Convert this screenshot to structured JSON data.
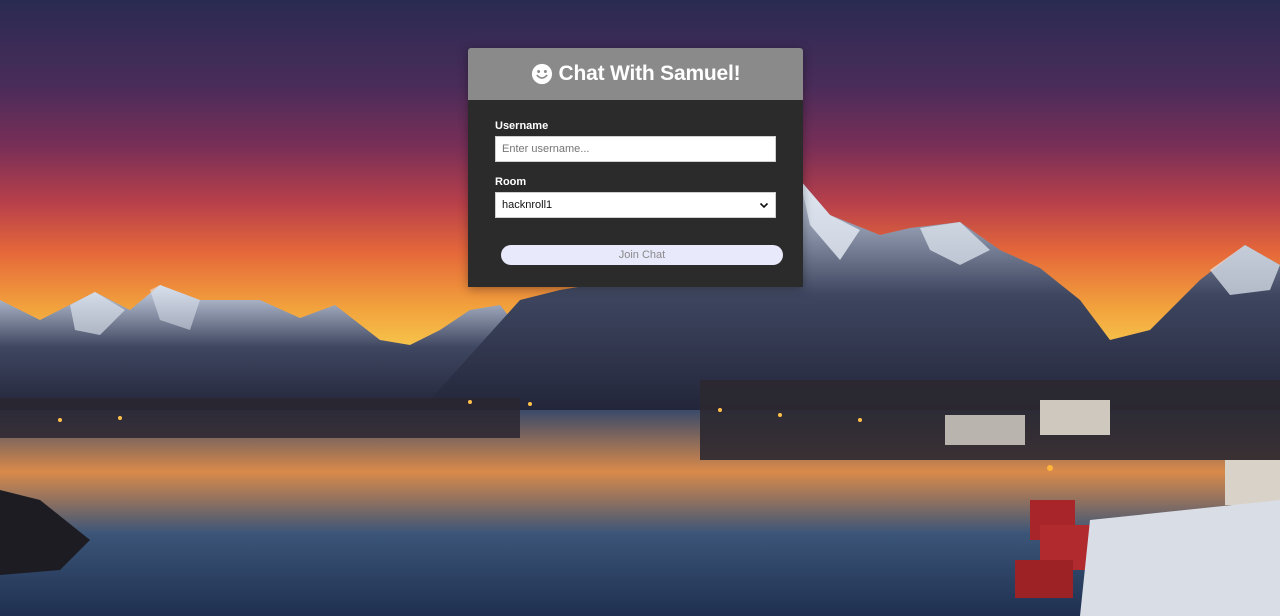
{
  "header": {
    "title": "Chat With Samuel!",
    "icon": "smile-icon"
  },
  "form": {
    "username": {
      "label": "Username",
      "placeholder": "Enter username...",
      "value": ""
    },
    "room": {
      "label": "Room",
      "selected": "hacknroll1"
    },
    "join_label": "Join Chat"
  },
  "colors": {
    "header_bg": "#8a8a8a",
    "card_bg": "#2b2b2b",
    "join_bg": "#e8e9fb",
    "join_text": "#8a8a8a"
  }
}
